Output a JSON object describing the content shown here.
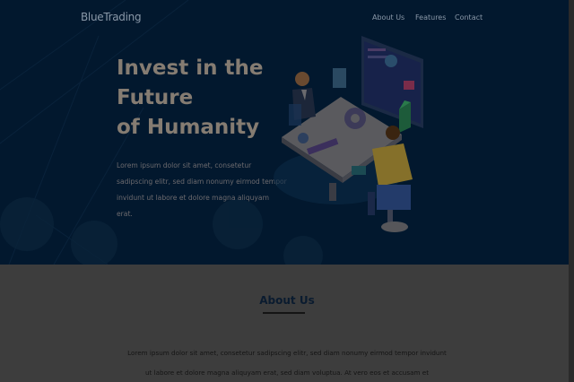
{
  "nav": {
    "logo": "BlueTrading",
    "links": [
      "About Us",
      "Features",
      "Contact"
    ]
  },
  "hero": {
    "title_lines": [
      "Invest in the",
      "Future",
      "of Humanity"
    ],
    "text": "Lorem ipsum dolor sit amet, consetetur sadipscing elitr, sed diam nonumy eirmod tempor invidunt ut labore et dolore magna aliquyam erat."
  },
  "about": {
    "title": "About Us",
    "text": "Lorem ipsum dolor sit amet, consetetur sadipscing elitr, sed diam nonumy eirmod tempor invidunt ut labore et dolore magna aliquyam erat, sed diam voluptua. At vero eos et accusam et"
  },
  "illustration": {
    "name": "meeting-table-illustration-icon"
  },
  "colors": {
    "hero_bg": "#02182e",
    "title": "#857c72",
    "overlay_bg": "#3d3d3d"
  }
}
